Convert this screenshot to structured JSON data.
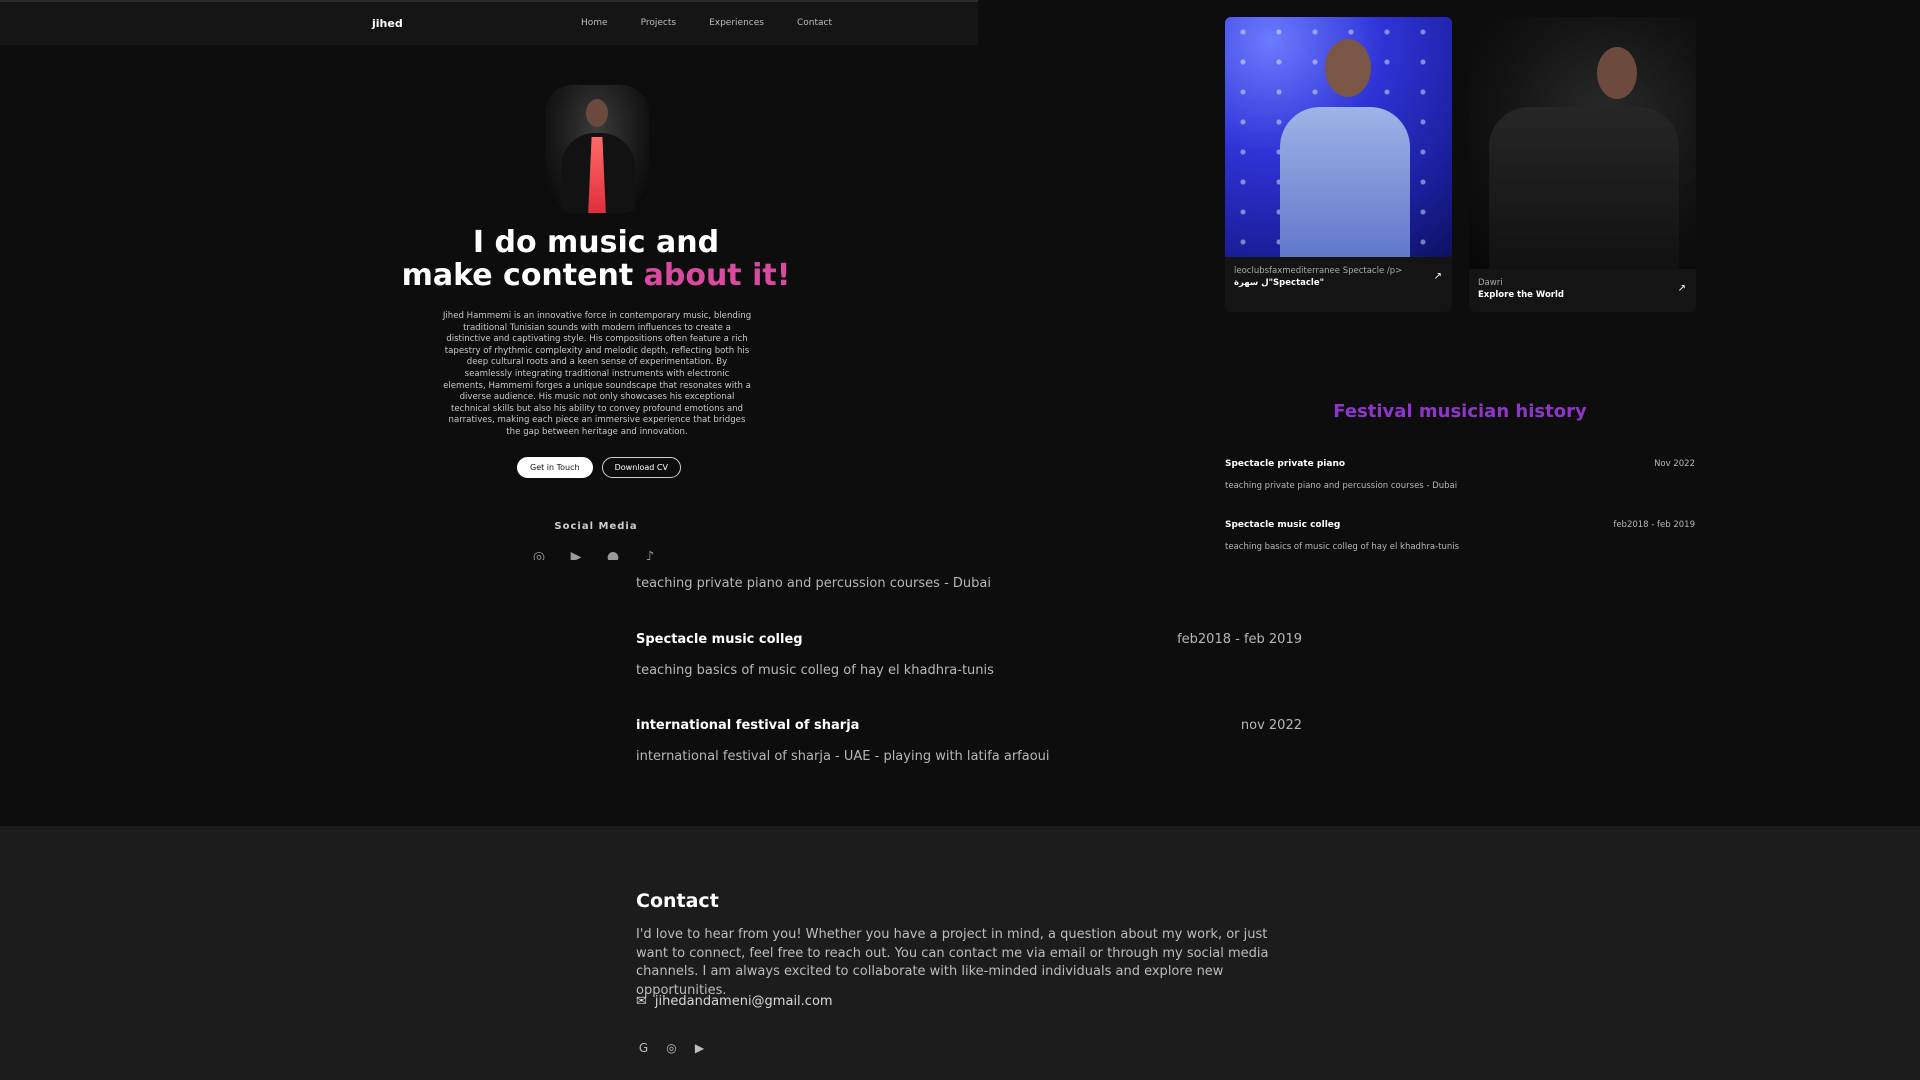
{
  "app": {
    "brand": "jihed"
  },
  "nav": {
    "items": [
      "Home",
      "Projects",
      "Experiences",
      "Contact"
    ]
  },
  "hero": {
    "headline_line1": "I do music and",
    "headline_line2a": "make content ",
    "headline_line2b": "about it!",
    "bio": "Jihed Hammemi is an innovative force in contemporary music, blending traditional Tunisian sounds with modern influences to create a distinctive and captivating style. His compositions often feature a rich tapestry of rhythmic complexity and melodic depth, reflecting both his deep cultural roots and a keen sense of experimentation. By seamlessly integrating traditional instruments with electronic elements, Hammemi forges a unique soundscape that resonates with a diverse audience. His music not only showcases his exceptional technical skills but also his ability to convey profound emotions and narratives, making each piece an immersive experience that bridges the gap between heritage and innovation.",
    "btn_contact": "Get in Touch",
    "btn_cv": "Download CV",
    "social_title": "Social Media",
    "social_icons": [
      "instagram-icon",
      "youtube-icon",
      "facebook-icon",
      "tiktok-icon"
    ]
  },
  "projects": [
    {
      "sub": "leoclubsfaxmediterranee Spectacle /p>",
      "title": "ل سهرة\"Spectacle\""
    },
    {
      "sub": "Dawri",
      "title": "Explore the World"
    }
  ],
  "history": {
    "title": "Festival musician history",
    "items": [
      {
        "name": "Spectacle private piano",
        "date": "Nov 2022",
        "desc": "teaching private piano and percussion courses - Dubai"
      },
      {
        "name": "Spectacle music colleg",
        "date": "feb2018 - feb 2019",
        "desc": "teaching basics of music colleg of hay el khadhra-tunis"
      }
    ]
  },
  "under_experience": {
    "desc0": "teaching private piano and percussion courses - Dubai",
    "items": [
      {
        "name": "Spectacle music colleg",
        "date": "feb2018 - feb 2019",
        "desc": "teaching basics of music colleg of hay el khadhra-tunis"
      },
      {
        "name": "international festival of sharja",
        "date": "nov 2022",
        "desc": "international festival of sharja - UAE - playing with latifa arfaoui"
      }
    ]
  },
  "contact": {
    "title": "Contact",
    "text": "I'd love to hear from you! Whether you have a project in mind, a question about my work, or just want to connect, feel free to reach out. You can contact me via email or through my social media channels. I am always excited to collaborate with like-minded individuals and explore new opportunities.",
    "email": "jihedandameni@gmail.com",
    "icons": [
      "google-icon",
      "instagram-icon",
      "youtube-icon"
    ]
  },
  "colors": {
    "accent_pink": "#d94aa0",
    "accent_purple": "#8e36c9",
    "background": "#0d0d0d"
  }
}
